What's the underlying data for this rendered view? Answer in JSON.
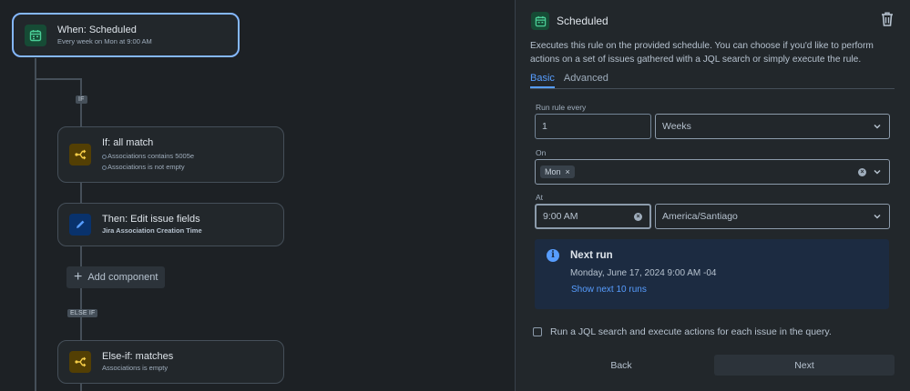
{
  "canvas": {
    "trigger": {
      "title": "When: Scheduled",
      "subtitle": "Every week on Mon at 9:00 AM"
    },
    "if_tag": "IF",
    "if_node": {
      "title": "If: all match",
      "conditions": [
        "Associations contains 5005e",
        "Associations is not empty"
      ]
    },
    "then_node": {
      "title": "Then: Edit issue fields",
      "subtitle": "Jira Association Creation Time"
    },
    "add_component": "Add component",
    "else_if_tag": "ELSE IF",
    "else_if_node": {
      "title": "Else-if: matches",
      "subtitle": "Associations is empty"
    }
  },
  "panel": {
    "title": "Scheduled",
    "description": "Executes this rule on the provided schedule. You can choose if you'd like to perform actions on a set of issues gathered with a JQL search or simply execute the rule.",
    "tabs": [
      "Basic",
      "Advanced"
    ],
    "active_tab": "Basic",
    "run_every_label": "Run rule every",
    "run_every_value": "1",
    "unit_value": "Weeks",
    "on_label": "On",
    "on_chip": "Mon",
    "at_label": "At",
    "time_value": "9:00 AM",
    "timezone_value": "America/Santiago",
    "next_run_title": "Next run",
    "next_run_value": "Monday, June 17, 2024 9:00 AM -04",
    "show_next_link": "Show next 10 runs",
    "jql_checkbox_label": "Run a JQL search and execute actions for each issue in the query.",
    "back_label": "Back",
    "next_label": "Next"
  },
  "colors": {
    "background": "#1d2125",
    "panel": "#22272b",
    "accent": "#579dff",
    "trigger_border": "#85b8ff",
    "green_icon": "#4bce97",
    "yellow_icon": "#f5cd47",
    "blue_icon": "#579dff"
  },
  "icons": [
    "calendar-icon",
    "branch-icon",
    "pencil-icon",
    "trash-icon",
    "chevron-down-icon",
    "clear-icon",
    "info-icon",
    "plus-icon"
  ]
}
